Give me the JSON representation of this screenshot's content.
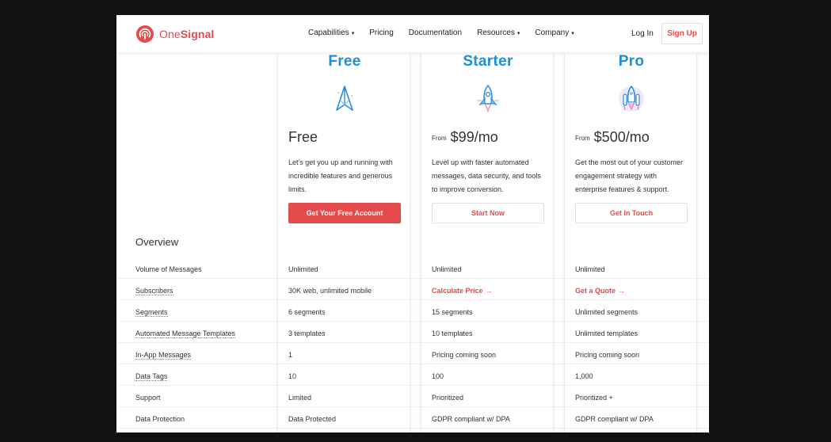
{
  "brand": {
    "name_part1": "One",
    "name_part2": "Signal",
    "accent": "#e54b4d",
    "plan_color": "#1a8fdd"
  },
  "nav": {
    "links": [
      {
        "label": "Capabilities",
        "dropdown": true
      },
      {
        "label": "Pricing",
        "dropdown": false
      },
      {
        "label": "Documentation",
        "dropdown": false
      },
      {
        "label": "Resources",
        "dropdown": true
      },
      {
        "label": "Company",
        "dropdown": true
      }
    ],
    "caret": "▾",
    "login": "Log In",
    "signup": "Sign Up"
  },
  "plans": [
    {
      "name": "Free",
      "icon": "paper-plane-icon",
      "from": "",
      "price": "Free",
      "description": "Let's get you up and running with incredible features and generous limits.",
      "cta": "Get Your Free Account"
    },
    {
      "name": "Starter",
      "icon": "rocket-icon",
      "from": "From",
      "price": "$99/mo",
      "description": "Level up with faster automated messages, data security, and tools to improve conversion.",
      "cta": "Start Now"
    },
    {
      "name": "Pro",
      "icon": "space-shuttle-icon",
      "from": "From",
      "price": "$500/mo",
      "description": "Get the most out of your customer engagement strategy with enterprise features & support.",
      "cta": "Get In Touch"
    }
  ],
  "table": {
    "section_title": "Overview",
    "arrow": "→",
    "rows": [
      {
        "label": "Volume of Messages",
        "free": "Unlimited",
        "starter": "Unlimited",
        "pro": "Unlimited"
      },
      {
        "label": "Subscribers",
        "free": "30K web, unlimited mobile",
        "starter": "Calculate Price",
        "pro": "Get a Quote"
      },
      {
        "label": "Segments",
        "free": "6 segments",
        "starter": "15 segments",
        "pro": "Unlimited segments"
      },
      {
        "label": "Automated Message Templates",
        "free": "3 templates",
        "starter": "10 templates",
        "pro": "Unlimited templates"
      },
      {
        "label": "In-App Messages",
        "free": "1",
        "starter": "Pricing coming soon",
        "pro": "Pricing coming soon"
      },
      {
        "label": "Data Tags",
        "free": "10",
        "starter": "100",
        "pro": "1,000"
      },
      {
        "label": "Support",
        "free": "Limited",
        "starter": "Prioritized",
        "pro": "Prioritized +"
      },
      {
        "label": "Data Protection",
        "free": "Data Protected",
        "starter": "GDPR compliant w/ DPA",
        "pro": "GDPR compliant w/ DPA"
      }
    ]
  }
}
